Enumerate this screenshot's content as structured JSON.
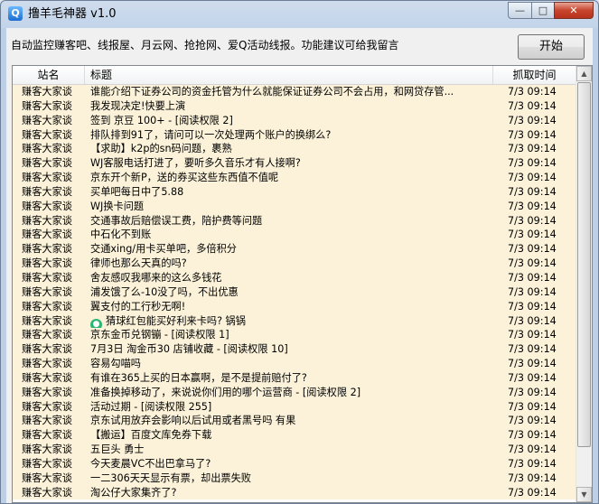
{
  "window": {
    "title": "撸羊毛神器 v1.0",
    "icon": "app-icon",
    "icon_glyph": "Q"
  },
  "controls": {
    "minimize": "—",
    "maximize": "□",
    "close": "✕"
  },
  "notice": "自动监控赚客吧、线报屋、月云网、抢抢网、爱Q活动线报。功能建议可给我留言",
  "start_button": "开始",
  "columns": {
    "site": "站名",
    "title": "标题",
    "time": "抓取时间"
  },
  "rows": [
    {
      "site": "赚客大家谈",
      "title": "谁能介绍下证券公司的资金托管为什么就能保证证券公司不会占用，和网贷存管...",
      "time": "7/3 09:14"
    },
    {
      "site": "赚客大家谈",
      "title": "我发现决定!快要上演",
      "time": "7/3 09:14"
    },
    {
      "site": "赚客大家谈",
      "title": "签到 京豆 100+ - [阅读权限 2]",
      "time": "7/3 09:14"
    },
    {
      "site": "赚客大家谈",
      "title": "排队排到91了，请问可以一次处理两个账户的换绑么?",
      "time": "7/3 09:14"
    },
    {
      "site": "赚客大家谈",
      "title": "【求助】k2p的sn码问题，裹熟",
      "time": "7/3 09:14"
    },
    {
      "site": "赚客大家谈",
      "title": "WJ客服电话打进了，要听多久音乐才有人接啊?",
      "time": "7/3 09:14"
    },
    {
      "site": "赚客大家谈",
      "title": "京东开个新P，送的券买这些东西值不值呢",
      "time": "7/3 09:14"
    },
    {
      "site": "赚客大家谈",
      "title": "买单吧每日中了5.88",
      "time": "7/3 09:14"
    },
    {
      "site": "赚客大家谈",
      "title": "WJ换卡问题",
      "time": "7/3 09:14"
    },
    {
      "site": "赚客大家谈",
      "title": "交通事故后赔偿误工费，陪护费等问题",
      "time": "7/3 09:14"
    },
    {
      "site": "赚客大家谈",
      "title": "中石化不到账",
      "time": "7/3 09:14"
    },
    {
      "site": "赚客大家谈",
      "title": "交通xing/用卡买单吧，多倍积分",
      "time": "7/3 09:14"
    },
    {
      "site": "赚客大家谈",
      "title": "律师也那么天真的吗?",
      "time": "7/3 09:14"
    },
    {
      "site": "赚客大家谈",
      "title": "舍友感叹我哪来的这么多钱花",
      "time": "7/3 09:14"
    },
    {
      "site": "赚客大家谈",
      "title": "浦发饿了么-10没了吗，不出优惠",
      "time": "7/3 09:14"
    },
    {
      "site": "赚客大家谈",
      "title": "翼支付的工行秒无啊!",
      "time": "7/3 09:14"
    },
    {
      "site": "赚客大家谈",
      "title": "猜球红包能买好利来卡吗? 锅锅",
      "time": "7/3 09:14",
      "icon": "location-pin-icon"
    },
    {
      "site": "赚客大家谈",
      "title": "京东金币兑钢镚 - [阅读权限 1]",
      "time": "7/3 09:14"
    },
    {
      "site": "赚客大家谈",
      "title": "7月3日 淘金币30 店铺收藏 - [阅读权限 10]",
      "time": "7/3 09:14"
    },
    {
      "site": "赚客大家谈",
      "title": "容易勾喵吗",
      "time": "7/3 09:14"
    },
    {
      "site": "赚客大家谈",
      "title": "有谁在365上买的日本赢啊，是不是提前赔付了?",
      "time": "7/3 09:14"
    },
    {
      "site": "赚客大家谈",
      "title": "准备换掉移动了，来说说你们用的哪个运营商 - [阅读权限 2]",
      "time": "7/3 09:14"
    },
    {
      "site": "赚客大家谈",
      "title": "活动过期 - [阅读权限 255]",
      "time": "7/3 09:14"
    },
    {
      "site": "赚客大家谈",
      "title": "京东试用放弃会影响以后试用或者黑号吗 有果",
      "time": "7/3 09:14"
    },
    {
      "site": "赚客大家谈",
      "title": "【搬运】百度文库免券下载",
      "time": "7/3 09:14"
    },
    {
      "site": "赚客大家谈",
      "title": "五巨头 勇士",
      "time": "7/3 09:14"
    },
    {
      "site": "赚客大家谈",
      "title": "今天麦晨VC不出巴拿马了?",
      "time": "7/3 09:14"
    },
    {
      "site": "赚客大家谈",
      "title": "一二306天天显示有票，却出票失败",
      "time": "7/3 09:14"
    },
    {
      "site": "赚客大家谈",
      "title": "淘公仔大家集齐了?",
      "time": "7/3 09:14"
    }
  ],
  "colors": {
    "row_bg": "#fbf2d9",
    "window_frame": "#c2d4ea",
    "close_button": "#c7452e"
  }
}
